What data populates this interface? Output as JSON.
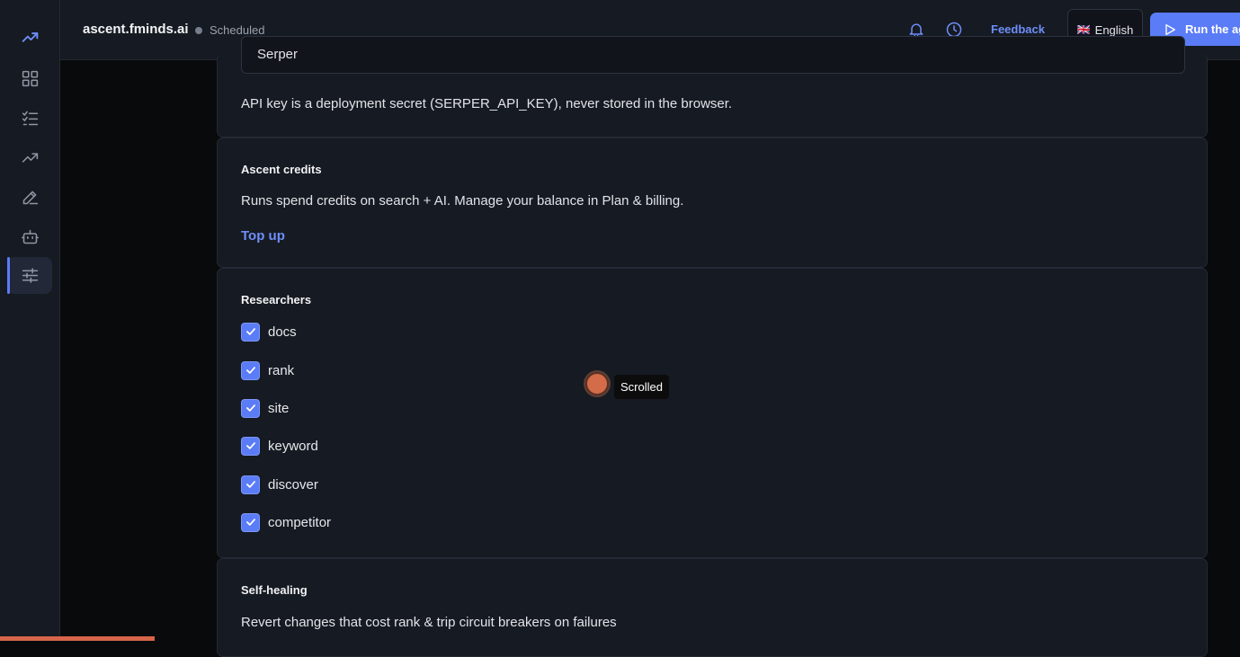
{
  "header": {
    "title": "ascent.fminds.ai",
    "status": "Scheduled",
    "feedback_label": "Feedback",
    "language_label": "English",
    "language_flag": "🇬🇧",
    "run_label": "Run the agent"
  },
  "sidebar": {
    "items": [
      {
        "icon": "trend-up-icon",
        "active": false
      },
      {
        "icon": "dashboard-grid-icon",
        "active": false
      },
      {
        "icon": "checklist-icon",
        "active": false
      },
      {
        "icon": "trending-icon",
        "active": false
      },
      {
        "icon": "edit-pencil-icon",
        "active": false
      },
      {
        "icon": "robot-icon",
        "active": false
      },
      {
        "icon": "settings-sliders-icon",
        "active": true
      }
    ]
  },
  "search_provider": {
    "value": "Serper",
    "note": "API key is a deployment secret (SERPER_API_KEY), never stored in the browser."
  },
  "credits": {
    "title": "Ascent credits",
    "description": "Runs spend credits on search + AI. Manage your balance in Plan & billing.",
    "link_label": "Top up"
  },
  "researchers": {
    "title": "Researchers",
    "items": [
      {
        "label": "docs",
        "checked": true
      },
      {
        "label": "rank",
        "checked": true
      },
      {
        "label": "site",
        "checked": true
      },
      {
        "label": "keyword",
        "checked": true
      },
      {
        "label": "discover",
        "checked": true
      },
      {
        "label": "competitor",
        "checked": true
      }
    ]
  },
  "self_healing": {
    "title": "Self-healing",
    "description": "Revert changes that cost rank & trip circuit breakers on failures"
  },
  "overlay": {
    "tooltip": "Scrolled"
  },
  "colors": {
    "accent": "#5b7cf7",
    "cursor": "#d46c49",
    "progress": "#d6654a"
  }
}
